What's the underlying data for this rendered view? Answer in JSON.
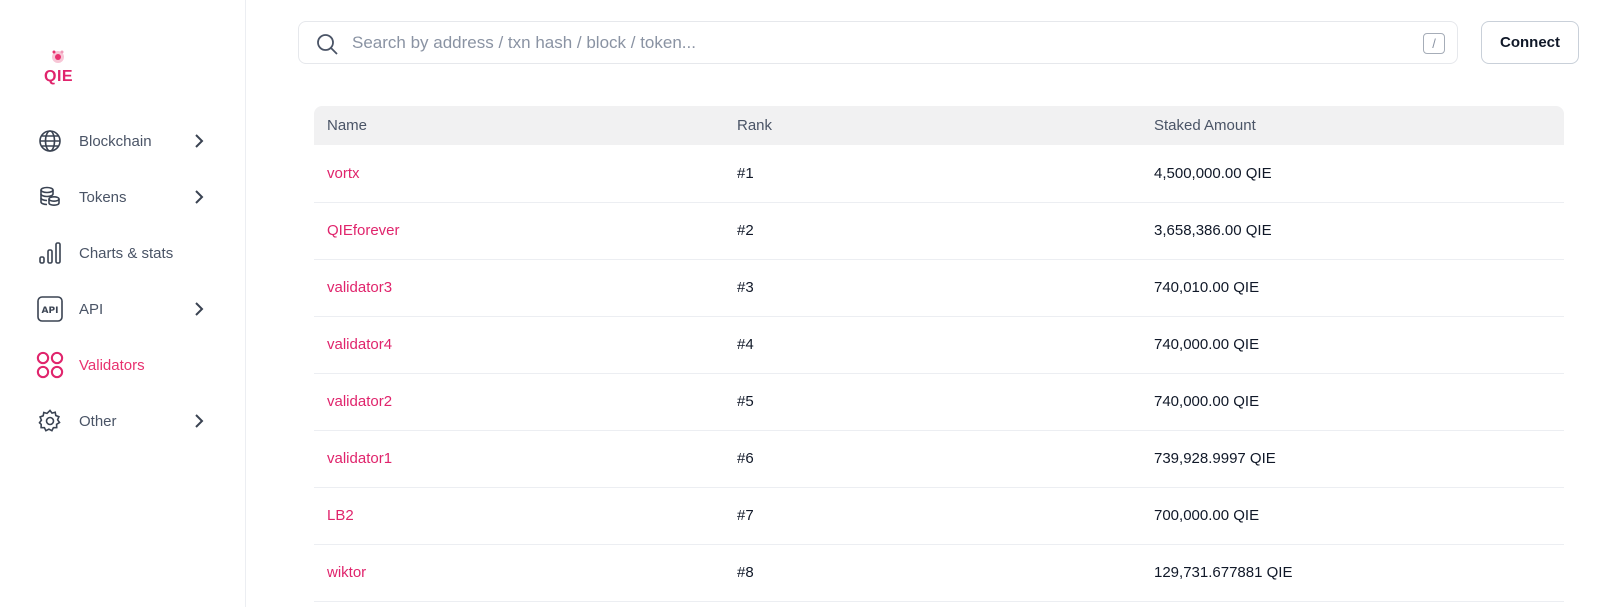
{
  "brand": {
    "logo_text": "QIE",
    "accent": "#e0246c"
  },
  "sidebar": {
    "items": [
      {
        "label": "Blockchain",
        "icon": "globe-icon",
        "has_chevron": true
      },
      {
        "label": "Tokens",
        "icon": "coins-icon",
        "has_chevron": true
      },
      {
        "label": "Charts & stats",
        "icon": "bar-chart-icon",
        "has_chevron": false
      },
      {
        "label": "API",
        "icon": "api-icon",
        "has_chevron": true
      },
      {
        "label": "Validators",
        "icon": "validators-icon",
        "has_chevron": false,
        "active": true
      },
      {
        "label": "Other",
        "icon": "gear-icon",
        "has_chevron": true
      }
    ]
  },
  "search": {
    "placeholder": "Search by address / txn hash / block / token...",
    "value": "",
    "shortcut": "/"
  },
  "header": {
    "connect_label": "Connect"
  },
  "table": {
    "columns": [
      "Name",
      "Rank",
      "Staked Amount"
    ],
    "rows": [
      {
        "name": "vortx",
        "rank": "#1",
        "staked": "4,500,000.00 QIE"
      },
      {
        "name": "QIEforever",
        "rank": "#2",
        "staked": "3,658,386.00 QIE"
      },
      {
        "name": "validator3",
        "rank": "#3",
        "staked": "740,010.00 QIE"
      },
      {
        "name": "validator4",
        "rank": "#4",
        "staked": "740,000.00 QIE"
      },
      {
        "name": "validator2",
        "rank": "#5",
        "staked": "740,000.00 QIE"
      },
      {
        "name": "validator1",
        "rank": "#6",
        "staked": "739,928.9997 QIE"
      },
      {
        "name": "LB2",
        "rank": "#7",
        "staked": "700,000.00 QIE"
      },
      {
        "name": "wiktor",
        "rank": "#8",
        "staked": "129,731.677881 QIE"
      }
    ]
  }
}
